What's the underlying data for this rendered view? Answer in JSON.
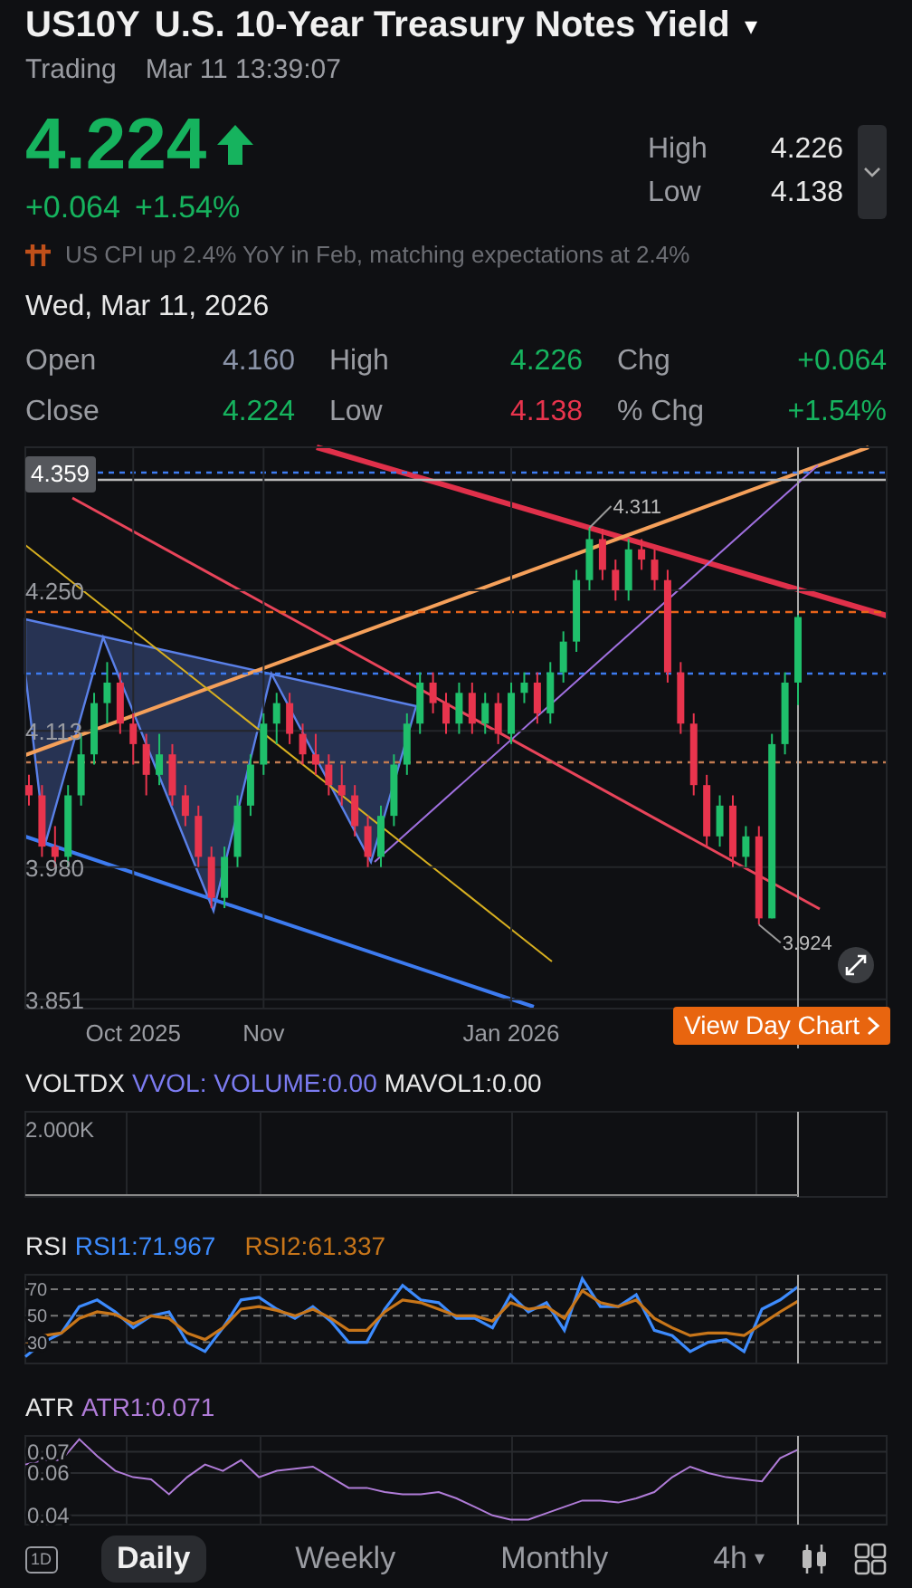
{
  "header": {
    "symbol": "US10Y",
    "name": "U.S. 10-Year Treasury Notes Yield",
    "menu_caret": "▾",
    "status": "Trading",
    "timestamp": "Mar 11 13:39:07"
  },
  "quote": {
    "price": "4.224",
    "rising": true,
    "change": "+0.064",
    "change_percent": "+1.54%",
    "stats": [
      {
        "label": "High",
        "value": "4.226"
      },
      {
        "label": "Low",
        "value": "4.138"
      }
    ]
  },
  "news": {
    "text": "US CPI up 2.4% YoY in Feb, matching expectations at 2.4%"
  },
  "day_detail": {
    "date": "Wed, Mar 11, 2026",
    "fields": [
      {
        "label": "Open",
        "value": "4.160",
        "color": "#8a93a8"
      },
      {
        "label": "High",
        "value": "4.226",
        "color": "#16b35e"
      },
      {
        "label": "Chg",
        "value": "+0.064",
        "color": "#16b35e"
      },
      {
        "label": "Close",
        "value": "4.224",
        "color": "#16b35e"
      },
      {
        "label": "Low",
        "value": "4.138",
        "color": "#e8344d"
      },
      {
        "label": "% Chg",
        "value": "+1.54%",
        "color": "#16b35e"
      }
    ]
  },
  "main_chart": {
    "cursor_price": "4.359",
    "button": "View Day Chart",
    "chart_data": {
      "type": "candlestick",
      "grid": true,
      "ylim": [
        3.842,
        4.3896
      ],
      "categories": [
        null,
        null,
        null,
        null,
        null,
        null,
        null,
        null,
        "Oct 2025",
        null,
        null,
        null,
        null,
        null,
        null,
        null,
        null,
        null,
        "Nov",
        null,
        null,
        null,
        null,
        null,
        null,
        null,
        null,
        null,
        null,
        null,
        null,
        null,
        null,
        null,
        null,
        null,
        null,
        "Jan 2026",
        null,
        null,
        null,
        null,
        null,
        null,
        null,
        null,
        null,
        null,
        null,
        null,
        null,
        null,
        null,
        null,
        null,
        null,
        null,
        null,
        null,
        null
      ],
      "yticks": [
        {
          "value": 3.851,
          "label": "3.851"
        },
        {
          "value": 3.98,
          "label": "3.980"
        },
        {
          "value": 4.113,
          "label": "4.113"
        },
        {
          "value": 4.25,
          "label": "4.250"
        }
      ],
      "ohlc": [
        [
          4.06,
          4.07,
          4.04,
          4.05
        ],
        [
          4.05,
          4.06,
          3.99,
          4.0
        ],
        [
          4.0,
          4.02,
          3.98,
          3.99
        ],
        [
          3.99,
          4.06,
          3.98,
          4.05
        ],
        [
          4.05,
          4.11,
          4.04,
          4.09
        ],
        [
          4.09,
          4.15,
          4.08,
          4.14
        ],
        [
          4.14,
          4.18,
          4.12,
          4.16
        ],
        [
          4.16,
          4.17,
          4.11,
          4.12
        ],
        [
          4.12,
          4.13,
          4.08,
          4.1
        ],
        [
          4.1,
          4.11,
          4.05,
          4.07
        ],
        [
          4.07,
          4.11,
          4.06,
          4.09
        ],
        [
          4.09,
          4.1,
          4.04,
          4.05
        ],
        [
          4.05,
          4.06,
          4.02,
          4.03
        ],
        [
          4.03,
          4.04,
          3.98,
          3.99
        ],
        [
          3.99,
          4.0,
          3.94,
          3.95
        ],
        [
          3.95,
          4.0,
          3.94,
          3.99
        ],
        [
          3.99,
          4.05,
          3.98,
          4.04
        ],
        [
          4.04,
          4.09,
          4.03,
          4.08
        ],
        [
          4.08,
          4.13,
          4.07,
          4.12
        ],
        [
          4.12,
          4.15,
          4.1,
          4.14
        ],
        [
          4.14,
          4.15,
          4.1,
          4.11
        ],
        [
          4.11,
          4.12,
          4.08,
          4.09
        ],
        [
          4.09,
          4.11,
          4.07,
          4.08
        ],
        [
          4.08,
          4.09,
          4.05,
          4.06
        ],
        [
          4.06,
          4.08,
          4.04,
          4.05
        ],
        [
          4.05,
          4.06,
          4.01,
          4.02
        ],
        [
          4.02,
          4.03,
          3.98,
          3.99
        ],
        [
          3.99,
          4.04,
          3.98,
          4.03
        ],
        [
          4.03,
          4.09,
          4.02,
          4.08
        ],
        [
          4.08,
          4.13,
          4.07,
          4.12
        ],
        [
          4.12,
          4.17,
          4.11,
          4.16
        ],
        [
          4.16,
          4.17,
          4.13,
          4.14
        ],
        [
          4.14,
          4.15,
          4.11,
          4.12
        ],
        [
          4.12,
          4.16,
          4.11,
          4.15
        ],
        [
          4.15,
          4.16,
          4.11,
          4.12
        ],
        [
          4.12,
          4.15,
          4.11,
          4.14
        ],
        [
          4.14,
          4.15,
          4.1,
          4.11
        ],
        [
          4.11,
          4.16,
          4.1,
          4.15
        ],
        [
          4.15,
          4.17,
          4.14,
          4.16
        ],
        [
          4.16,
          4.17,
          4.12,
          4.13
        ],
        [
          4.13,
          4.18,
          4.12,
          4.17
        ],
        [
          4.17,
          4.21,
          4.16,
          4.2
        ],
        [
          4.2,
          4.27,
          4.19,
          4.26
        ],
        [
          4.26,
          4.311,
          4.25,
          4.3
        ],
        [
          4.3,
          4.31,
          4.26,
          4.27
        ],
        [
          4.27,
          4.28,
          4.24,
          4.25
        ],
        [
          4.25,
          4.3,
          4.24,
          4.29
        ],
        [
          4.29,
          4.3,
          4.27,
          4.28
        ],
        [
          4.28,
          4.29,
          4.25,
          4.26
        ],
        [
          4.26,
          4.27,
          4.16,
          4.17
        ],
        [
          4.17,
          4.18,
          4.11,
          4.12
        ],
        [
          4.12,
          4.13,
          4.05,
          4.06
        ],
        [
          4.06,
          4.07,
          4.0,
          4.01
        ],
        [
          4.01,
          4.05,
          4.0,
          4.04
        ],
        [
          4.04,
          4.05,
          3.98,
          3.99
        ],
        [
          3.99,
          4.02,
          3.98,
          4.01
        ],
        [
          4.01,
          4.02,
          3.924,
          3.93
        ],
        [
          3.93,
          4.11,
          3.93,
          4.1
        ],
        [
          4.1,
          4.17,
          4.09,
          4.16
        ],
        [
          4.16,
          4.226,
          4.138,
          4.224
        ]
      ],
      "annotations": [
        "4.311",
        "3.924"
      ]
    }
  },
  "volume": {
    "title": "VOLTDX",
    "legend": [
      {
        "text": "VVOL: VOLUME:0.00",
        "color": "#7b7bf0"
      },
      {
        "text": "MAVOL1:0.00",
        "color": "#e8e8e8"
      }
    ],
    "scale_label": "2.000K"
  },
  "rsi": {
    "title": "RSI",
    "legend": [
      {
        "text": "RSI1:71.967",
        "color": "#3d8bfd"
      },
      {
        "text": "RSI2:61.337",
        "color": "#c8761a"
      }
    ],
    "chart_data": {
      "type": "line",
      "grid": true,
      "ylim": [
        14,
        81
      ],
      "categories": [
        null,
        null,
        null,
        null,
        null,
        null,
        null,
        null,
        null,
        null,
        null,
        null,
        null,
        null,
        null,
        null,
        null,
        null,
        null,
        null,
        null,
        null,
        null,
        null,
        null,
        null,
        null,
        null,
        null,
        null,
        null,
        null,
        null,
        null,
        null,
        null,
        null,
        null,
        null,
        null,
        null,
        null,
        null,
        null
      ],
      "yticks": [
        30,
        50,
        70
      ],
      "series": [
        {
          "color": "#3d8bfd",
          "values": [
            19,
            30,
            37,
            57,
            62,
            53,
            41,
            50,
            53,
            30,
            23,
            41,
            62,
            64,
            55,
            48,
            57,
            46,
            30,
            30,
            55,
            73,
            62,
            60,
            48,
            48,
            41,
            66,
            53,
            60,
            39,
            78,
            57,
            57,
            66,
            39,
            35,
            23,
            30,
            32,
            23,
            55,
            62,
            72
          ]
        },
        {
          "color": "#c8761a",
          "values": [
            28,
            35,
            37,
            48,
            53,
            51,
            44,
            50,
            48,
            37,
            32,
            41,
            55,
            57,
            54,
            50,
            55,
            48,
            39,
            39,
            53,
            62,
            60,
            55,
            50,
            50,
            46,
            60,
            55,
            57,
            48,
            69,
            60,
            57,
            62,
            48,
            41,
            35,
            37,
            37,
            35,
            44,
            53,
            61
          ]
        }
      ]
    }
  },
  "atr": {
    "title": "ATR",
    "legend": [
      {
        "text": "ATR1:0.071",
        "color": "#b07cd8"
      }
    ],
    "chart_data": {
      "type": "line",
      "grid": true,
      "ylim": [
        0.0356,
        0.0775
      ],
      "categories": [
        null,
        null,
        null,
        null,
        null,
        null,
        null,
        null,
        null,
        null,
        null,
        null,
        null,
        null,
        null,
        null,
        null,
        null,
        null,
        null,
        null,
        null,
        null,
        null,
        null,
        null,
        null,
        null,
        null,
        null,
        null,
        null,
        null,
        null,
        null,
        null,
        null,
        null,
        null,
        null,
        null,
        null,
        null,
        null
      ],
      "yticks": [
        0.04,
        0.06,
        0.07
      ],
      "series": [
        {
          "color": "#b07cd8",
          "values": [
            0.064,
            0.066,
            0.066,
            0.076,
            0.068,
            0.061,
            0.058,
            0.057,
            0.05,
            0.058,
            0.064,
            0.061,
            0.066,
            0.058,
            0.061,
            0.062,
            0.063,
            0.058,
            0.053,
            0.053,
            0.051,
            0.05,
            0.05,
            0.051,
            0.048,
            0.044,
            0.04,
            0.038,
            0.038,
            0.041,
            0.044,
            0.047,
            0.047,
            0.046,
            0.048,
            0.051,
            0.058,
            0.063,
            0.06,
            0.058,
            0.057,
            0.056,
            0.067,
            0.071
          ]
        }
      ]
    }
  },
  "bottom_bar": {
    "day_icon": "1D",
    "periods": [
      {
        "label": "Daily",
        "selected": true
      },
      {
        "label": "Weekly",
        "selected": false
      },
      {
        "label": "Monthly",
        "selected": false
      }
    ],
    "interval": {
      "label": "4h",
      "caret": "▾"
    }
  }
}
